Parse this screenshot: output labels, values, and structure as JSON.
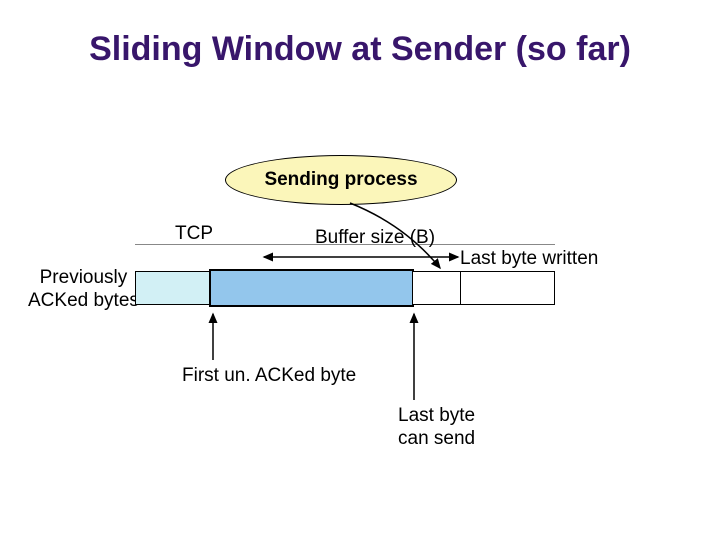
{
  "title": "Sliding Window at Sender (so far)",
  "process": "Sending process",
  "tcp": "TCP",
  "buffer_size": "Buffer size (B)",
  "last_written": "Last byte written",
  "prev_acked_line1": "Previously",
  "prev_acked_line2": "ACKed bytes",
  "first_unacked": "First un. ACKed byte",
  "last_cansend_line1": "Last byte",
  "last_cansend_line2": "can send"
}
